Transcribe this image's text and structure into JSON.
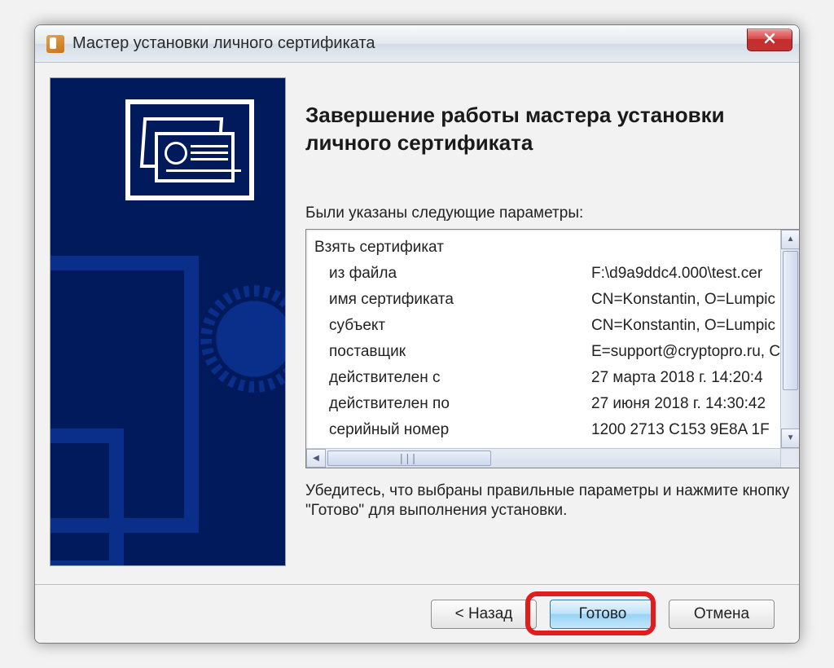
{
  "window": {
    "title": "Мастер установки личного сертификата"
  },
  "content": {
    "heading": "Завершение работы мастера установки личного сертификата",
    "params_label": "Были указаны следующие параметры:",
    "rows": [
      {
        "key": "Взять сертификат",
        "val": ""
      },
      {
        "key": "из файла",
        "val": "F:\\d9a9ddc4.000\\test.cer"
      },
      {
        "key": "имя сертификата",
        "val": "CN=Konstantin, O=Lumpic"
      },
      {
        "key": "субъект",
        "val": "CN=Konstantin, O=Lumpic"
      },
      {
        "key": "поставщик",
        "val": "E=support@cryptopro.ru, C"
      },
      {
        "key": "действителен с",
        "val": "27 марта 2018 г. 14:20:4"
      },
      {
        "key": "действителен по",
        "val": "27 июня 2018 г. 14:30:42"
      },
      {
        "key": "серийный номер",
        "val": "1200 2713 C153 9E8A 1F"
      }
    ],
    "note": "Убедитесь, что выбраны правильные параметры и нажмите кнопку \"Готово\" для выполнения установки."
  },
  "buttons": {
    "back": "< Назад",
    "finish": "Готово",
    "cancel": "Отмена"
  }
}
